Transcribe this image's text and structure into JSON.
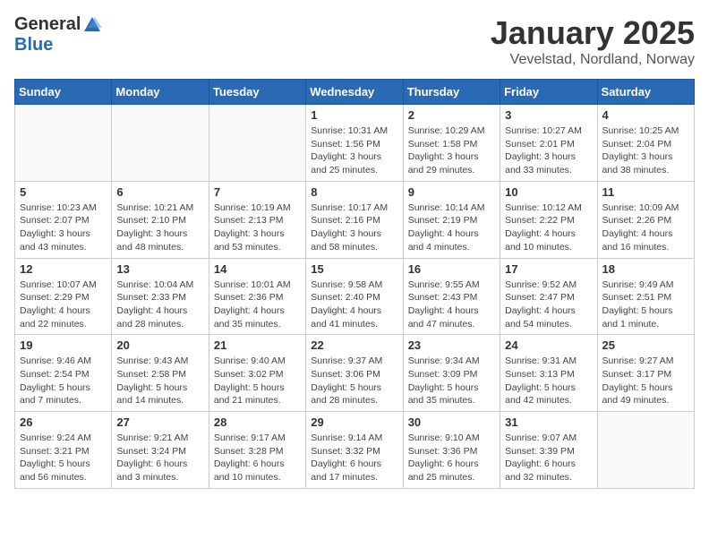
{
  "header": {
    "logo_general": "General",
    "logo_blue": "Blue",
    "month_title": "January 2025",
    "location": "Vevelstad, Nordland, Norway"
  },
  "weekdays": [
    "Sunday",
    "Monday",
    "Tuesday",
    "Wednesday",
    "Thursday",
    "Friday",
    "Saturday"
  ],
  "weeks": [
    [
      {
        "day": "",
        "info": ""
      },
      {
        "day": "",
        "info": ""
      },
      {
        "day": "",
        "info": ""
      },
      {
        "day": "1",
        "info": "Sunrise: 10:31 AM\nSunset: 1:56 PM\nDaylight: 3 hours\nand 25 minutes."
      },
      {
        "day": "2",
        "info": "Sunrise: 10:29 AM\nSunset: 1:58 PM\nDaylight: 3 hours\nand 29 minutes."
      },
      {
        "day": "3",
        "info": "Sunrise: 10:27 AM\nSunset: 2:01 PM\nDaylight: 3 hours\nand 33 minutes."
      },
      {
        "day": "4",
        "info": "Sunrise: 10:25 AM\nSunset: 2:04 PM\nDaylight: 3 hours\nand 38 minutes."
      }
    ],
    [
      {
        "day": "5",
        "info": "Sunrise: 10:23 AM\nSunset: 2:07 PM\nDaylight: 3 hours\nand 43 minutes."
      },
      {
        "day": "6",
        "info": "Sunrise: 10:21 AM\nSunset: 2:10 PM\nDaylight: 3 hours\nand 48 minutes."
      },
      {
        "day": "7",
        "info": "Sunrise: 10:19 AM\nSunset: 2:13 PM\nDaylight: 3 hours\nand 53 minutes."
      },
      {
        "day": "8",
        "info": "Sunrise: 10:17 AM\nSunset: 2:16 PM\nDaylight: 3 hours\nand 58 minutes."
      },
      {
        "day": "9",
        "info": "Sunrise: 10:14 AM\nSunset: 2:19 PM\nDaylight: 4 hours\nand 4 minutes."
      },
      {
        "day": "10",
        "info": "Sunrise: 10:12 AM\nSunset: 2:22 PM\nDaylight: 4 hours\nand 10 minutes."
      },
      {
        "day": "11",
        "info": "Sunrise: 10:09 AM\nSunset: 2:26 PM\nDaylight: 4 hours\nand 16 minutes."
      }
    ],
    [
      {
        "day": "12",
        "info": "Sunrise: 10:07 AM\nSunset: 2:29 PM\nDaylight: 4 hours\nand 22 minutes."
      },
      {
        "day": "13",
        "info": "Sunrise: 10:04 AM\nSunset: 2:33 PM\nDaylight: 4 hours\nand 28 minutes."
      },
      {
        "day": "14",
        "info": "Sunrise: 10:01 AM\nSunset: 2:36 PM\nDaylight: 4 hours\nand 35 minutes."
      },
      {
        "day": "15",
        "info": "Sunrise: 9:58 AM\nSunset: 2:40 PM\nDaylight: 4 hours\nand 41 minutes."
      },
      {
        "day": "16",
        "info": "Sunrise: 9:55 AM\nSunset: 2:43 PM\nDaylight: 4 hours\nand 47 minutes."
      },
      {
        "day": "17",
        "info": "Sunrise: 9:52 AM\nSunset: 2:47 PM\nDaylight: 4 hours\nand 54 minutes."
      },
      {
        "day": "18",
        "info": "Sunrise: 9:49 AM\nSunset: 2:51 PM\nDaylight: 5 hours\nand 1 minute."
      }
    ],
    [
      {
        "day": "19",
        "info": "Sunrise: 9:46 AM\nSunset: 2:54 PM\nDaylight: 5 hours\nand 7 minutes."
      },
      {
        "day": "20",
        "info": "Sunrise: 9:43 AM\nSunset: 2:58 PM\nDaylight: 5 hours\nand 14 minutes."
      },
      {
        "day": "21",
        "info": "Sunrise: 9:40 AM\nSunset: 3:02 PM\nDaylight: 5 hours\nand 21 minutes."
      },
      {
        "day": "22",
        "info": "Sunrise: 9:37 AM\nSunset: 3:06 PM\nDaylight: 5 hours\nand 28 minutes."
      },
      {
        "day": "23",
        "info": "Sunrise: 9:34 AM\nSunset: 3:09 PM\nDaylight: 5 hours\nand 35 minutes."
      },
      {
        "day": "24",
        "info": "Sunrise: 9:31 AM\nSunset: 3:13 PM\nDaylight: 5 hours\nand 42 minutes."
      },
      {
        "day": "25",
        "info": "Sunrise: 9:27 AM\nSunset: 3:17 PM\nDaylight: 5 hours\nand 49 minutes."
      }
    ],
    [
      {
        "day": "26",
        "info": "Sunrise: 9:24 AM\nSunset: 3:21 PM\nDaylight: 5 hours\nand 56 minutes."
      },
      {
        "day": "27",
        "info": "Sunrise: 9:21 AM\nSunset: 3:24 PM\nDaylight: 6 hours\nand 3 minutes."
      },
      {
        "day": "28",
        "info": "Sunrise: 9:17 AM\nSunset: 3:28 PM\nDaylight: 6 hours\nand 10 minutes."
      },
      {
        "day": "29",
        "info": "Sunrise: 9:14 AM\nSunset: 3:32 PM\nDaylight: 6 hours\nand 17 minutes."
      },
      {
        "day": "30",
        "info": "Sunrise: 9:10 AM\nSunset: 3:36 PM\nDaylight: 6 hours\nand 25 minutes."
      },
      {
        "day": "31",
        "info": "Sunrise: 9:07 AM\nSunset: 3:39 PM\nDaylight: 6 hours\nand 32 minutes."
      },
      {
        "day": "",
        "info": ""
      }
    ]
  ]
}
